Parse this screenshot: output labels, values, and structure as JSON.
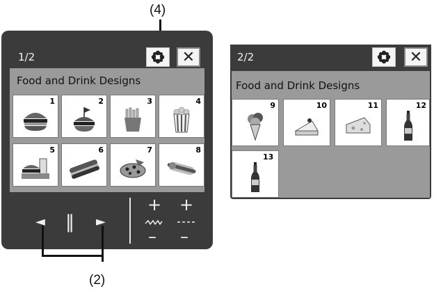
{
  "callouts": {
    "top": "(4)",
    "bottom": "(2)"
  },
  "panel1": {
    "page": "1/2",
    "category": "Food and Drink Designs",
    "tiles": [
      {
        "num": "1",
        "icon": "hamburger-icon"
      },
      {
        "num": "2",
        "icon": "burger-flag-icon"
      },
      {
        "num": "3",
        "icon": "fries-icon"
      },
      {
        "num": "4",
        "icon": "popcorn-icon"
      },
      {
        "num": "5",
        "icon": "combo-meal-icon"
      },
      {
        "num": "6",
        "icon": "sub-sandwich-icon"
      },
      {
        "num": "7",
        "icon": "pizza-icon"
      },
      {
        "num": "8",
        "icon": "hotdog-icon"
      }
    ],
    "controls": {
      "prev": "◄",
      "pause": "‖",
      "next": "►",
      "plus": "+",
      "minus": "–"
    }
  },
  "panel2": {
    "page": "2/2",
    "category": "Food and Drink Designs",
    "tiles": [
      {
        "num": "9",
        "icon": "ice-cream-icon"
      },
      {
        "num": "10",
        "icon": "cake-slice-icon"
      },
      {
        "num": "11",
        "icon": "cheese-icon"
      },
      {
        "num": "12",
        "icon": "bottle-icon"
      },
      {
        "num": "13",
        "icon": "bottle-icon"
      }
    ]
  },
  "close_glyph": "✕"
}
